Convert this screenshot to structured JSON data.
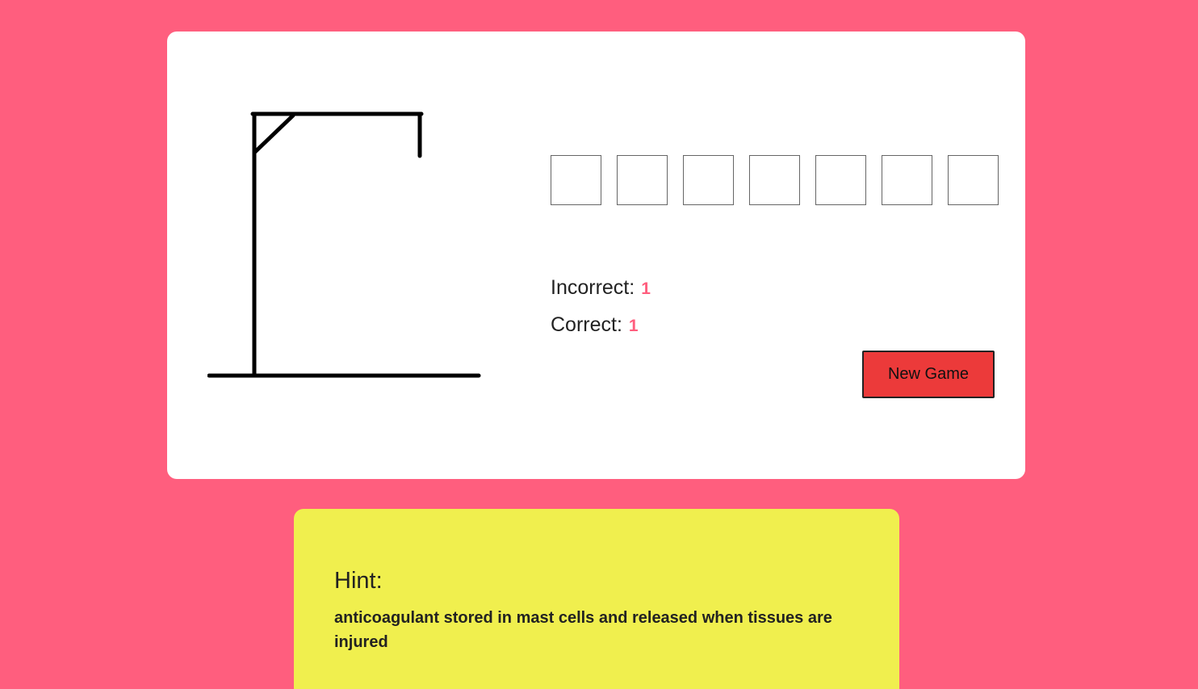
{
  "game": {
    "letters": [
      "",
      "",
      "",
      "",
      "",
      "",
      ""
    ],
    "incorrect_label": "Incorrect:",
    "incorrect_count": "1",
    "correct_label": "Correct:",
    "correct_count": "1",
    "new_game_label": "New Game"
  },
  "hint": {
    "title": "Hint:",
    "text": "anticoagulant stored in mast cells and released when tissues are injured"
  },
  "colors": {
    "background": "#ff5e7e",
    "card": "#ffffff",
    "hint_card": "#f0ef4e",
    "button": "#ec3a3a",
    "count_accent": "#ff5e7e"
  },
  "icons": {
    "gallows": "gallows-drawing"
  }
}
